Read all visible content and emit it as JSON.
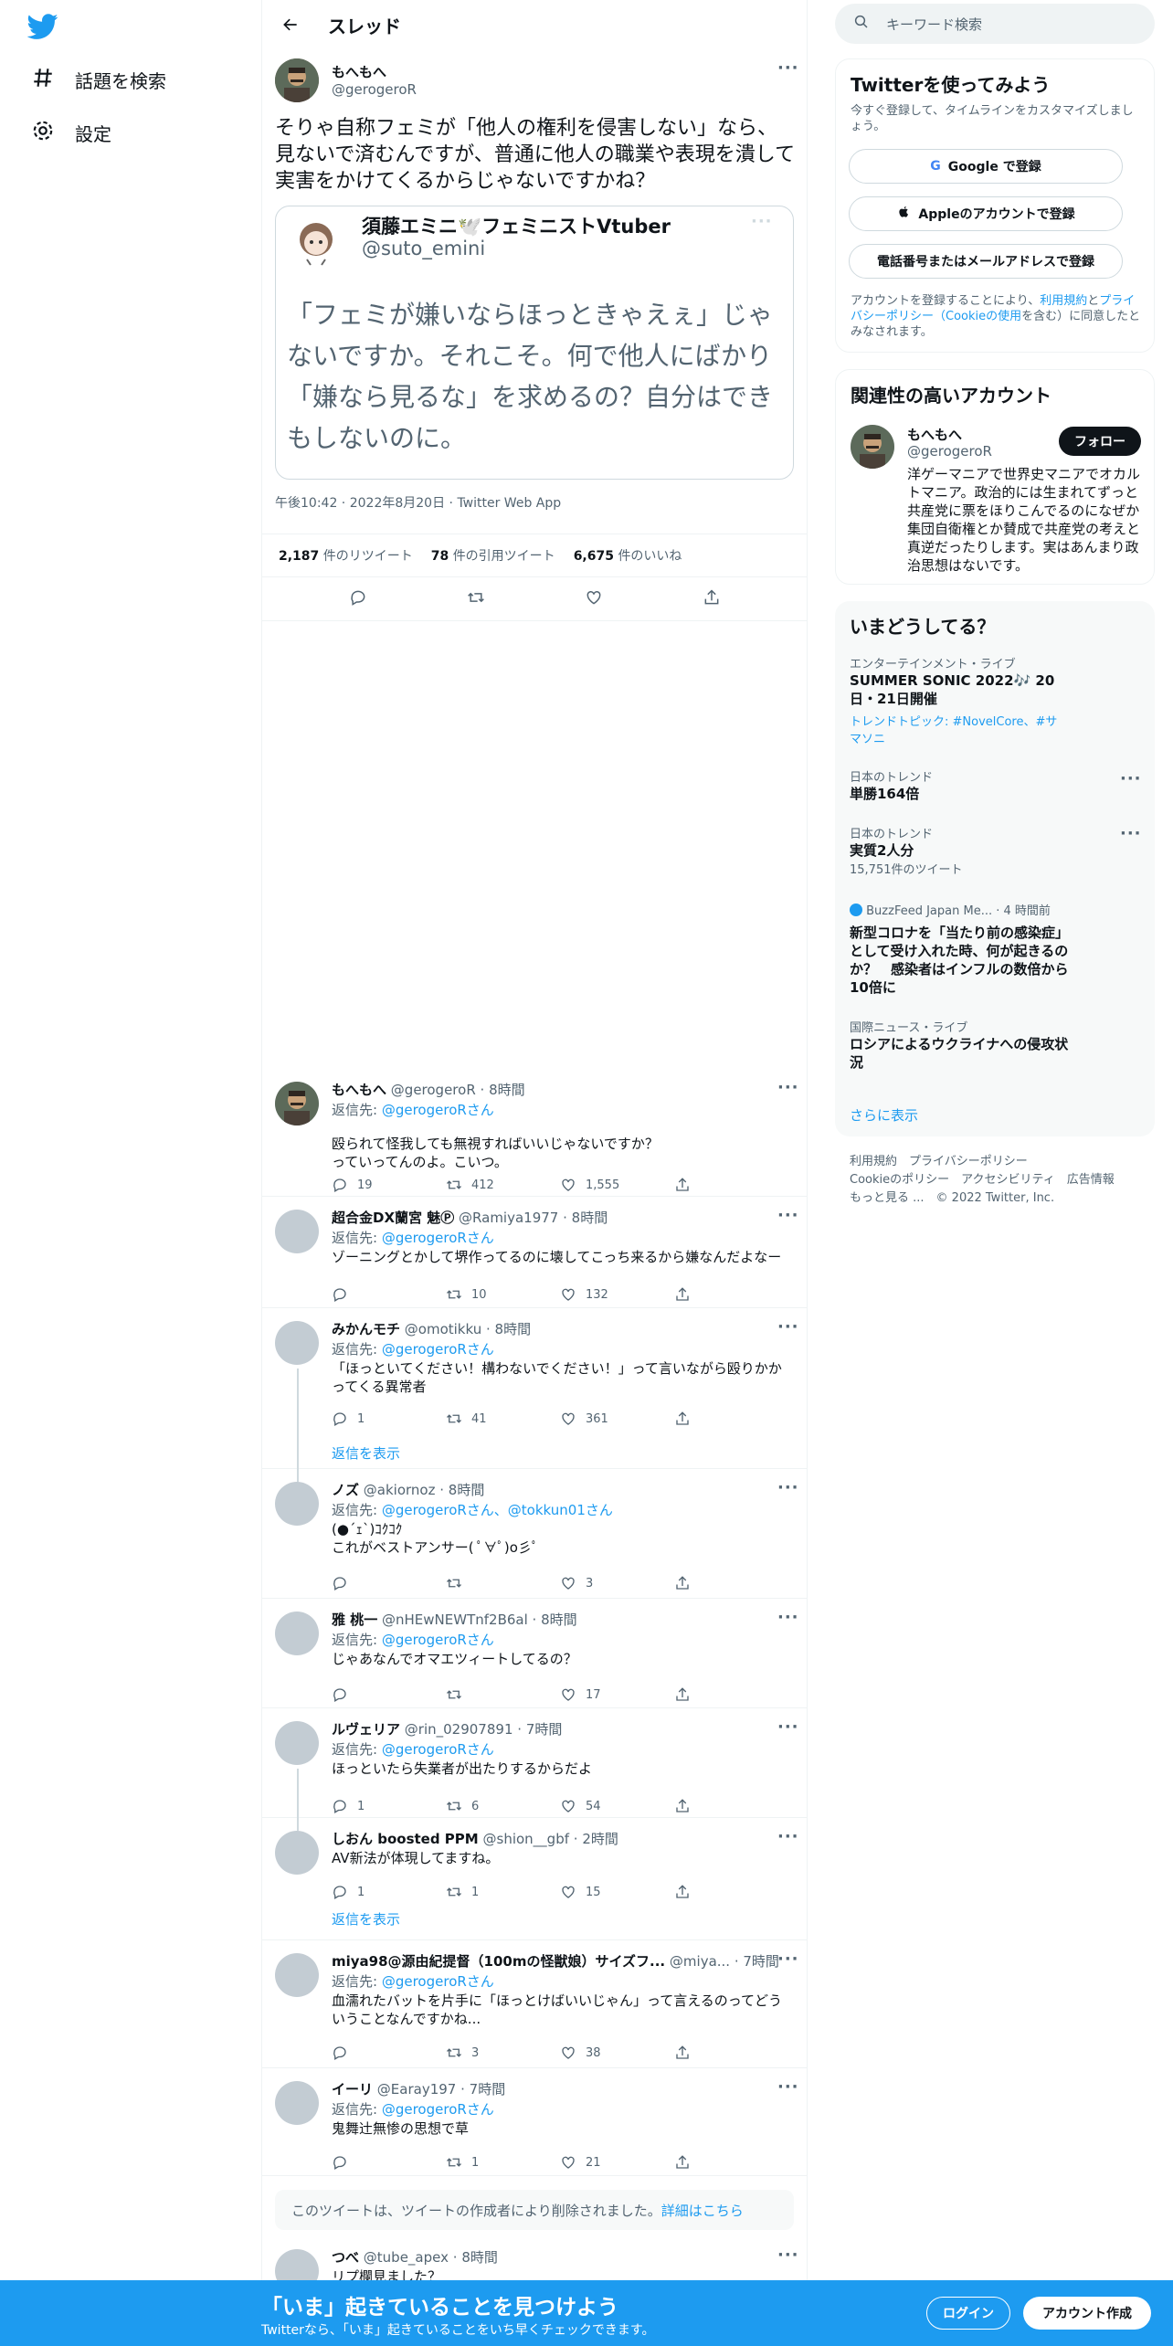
{
  "sidebar": {
    "explore": "話題を検索",
    "settings": "設定"
  },
  "header": {
    "title": "スレッド"
  },
  "tweet": {
    "name": "もへもへ",
    "handle": "@gerogeroR",
    "text": "そりゃ自称フェミが「他人の権利を侵害しない」なら、見ないで済むんですが、普通に他人の職業や表現を潰して実害をかけてくるからじゃないですかね？",
    "quote": {
      "name": "須藤エミニ🕊️フェミニストVtuber",
      "handle": "@suto_emini",
      "text": "「フェミが嫌いならほっときゃえぇ」じゃないですか。それこそ。何で他人にばかり「嫌なら見るな」を求めるの？自分はできもしないのに。"
    },
    "time": "午後10:42",
    "date": "2022年8月20日",
    "source": "Twitter Web App",
    "retweets": "2,187",
    "retweets_label": "件のリツイート",
    "quotes": "78",
    "quotes_label": "件の引用ツイート",
    "likes": "6,675",
    "likes_label": "件のいいね"
  },
  "replies": [
    {
      "name": "もへもへ",
      "handle": "@gerogeroR",
      "time": "8時間",
      "to_label": "返信先:",
      "to": "@gerogeroRさん",
      "text": "殴られて怪我しても無視すればいいじゃないですか？\nっていってんのよ。こいつ。",
      "reply": "19",
      "rt": "412",
      "like": "1,555"
    },
    {
      "name": "超合金DX蘭宮 魅Ⓟ",
      "handle": "@Ramiya1977",
      "time": "8時間",
      "to_label": "返信先:",
      "to": "@gerogeroRさん",
      "text": "ゾーニングとかして堺作ってるのに壊してこっち来るから嫌なんだよなー",
      "reply": "",
      "rt": "10",
      "like": "132"
    },
    {
      "name": "みかんモチ",
      "handle": "@omotikku",
      "time": "8時間",
      "to_label": "返信先:",
      "to": "@gerogeroRさん",
      "text": "「ほっといてください！構わないでください！」って言いながら殴りかかってくる異常者",
      "reply": "1",
      "rt": "41",
      "like": "361",
      "more": "返信を表示"
    },
    {
      "name": "ノズ",
      "handle": "@akiornoz",
      "time": "8時間",
      "to_label": "返信先:",
      "to": "@gerogeroRさん、@tokkun01さん",
      "text": "(●´ｪ`)ｺｸｺｸ\nこれがベストアンサー( ﾟ∀ﾟ)o彡ﾟ",
      "reply": "",
      "rt": "",
      "like": "3"
    },
    {
      "name": "雅 桃一",
      "handle": "@nHEwNEWTnf2B6al",
      "time": "8時間",
      "to_label": "返信先:",
      "to": "@gerogeroRさん",
      "text": "じゃあなんでオマエツィートしてるの？",
      "reply": "",
      "rt": "",
      "like": "17"
    },
    {
      "name": "ルヴェリア",
      "handle": "@rin_02907891",
      "time": "7時間",
      "to_label": "返信先:",
      "to": "@gerogeroRさん",
      "text": "ほっといたら失業者が出たりするからだよ",
      "reply": "1",
      "rt": "6",
      "like": "54"
    },
    {
      "name": "しおん boosted PPM",
      "handle": "@shion__gbf",
      "time": "2時間",
      "text": "AV新法が体現してますね。",
      "reply": "1",
      "rt": "1",
      "like": "15",
      "more": "返信を表示"
    },
    {
      "name": "miya98@源由紀提督（100mの怪獣娘）サイズフ...",
      "handle": "@miya...",
      "time": "7時間",
      "to_label": "返信先:",
      "to": "@gerogeroRさん",
      "text": "血濡れたバットを片手に「ほっとけばいいじゃん」って言えるのってどういうことなんですかね...",
      "reply": "",
      "rt": "3",
      "like": "38"
    },
    {
      "name": "イーリ",
      "handle": "@Earay197",
      "time": "7時間",
      "to_label": "返信先:",
      "to": "@gerogeroRさん",
      "text": "鬼舞辻無惨の思想で草",
      "reply": "",
      "rt": "1",
      "like": "21"
    },
    {
      "name": "つべ",
      "handle": "@tube_apex",
      "time": "8時間",
      "text": "リプ欄見ました？"
    }
  ],
  "deleted": {
    "text": "このツイートは、ツイートの作成者により削除されました。",
    "link": "詳細はこちら"
  },
  "right": {
    "search_placeholder": "キーワード検索",
    "signup": {
      "title": "Twitterを使ってみよう",
      "sub": "今すぐ登録して、タイムラインをカスタマイズしましょう。",
      "google": "Google で登録",
      "apple": "Appleのアカウントで登録",
      "phone": "電話番号またはメールアドレスで登録",
      "legal1": "アカウントを登録することにより、",
      "legal_terms": "利用規約",
      "legal2": "と",
      "legal_privacy": "プライバシーポリシー（Cookieの使用",
      "legal3": "を含む）に同意したとみなされます。"
    },
    "related": {
      "title": "関連性の高いアカウント",
      "name": "もへもへ",
      "handle": "@gerogeroR",
      "follow": "フォロー",
      "bio": "洋ゲーマニアで世界史マニアでオカルトマニア。政治的には生まれてずっと共産党に票をほりこんでるのになぜか集団自衛権とか賛成で共産党の考えと真逆だったりします。実はあんまり政治思想はないです。"
    },
    "trends": {
      "title": "いまどうしてる？",
      "items": [
        {
          "cat": "エンターテインメント・ライブ",
          "title": "SUMMER SONIC 2022🎶 20日・21日開催",
          "extra": "トレンドトピック: #NovelCore、#サマソニ"
        },
        {
          "cat": "日本のトレンド",
          "title": "単勝164倍"
        },
        {
          "cat": "日本のトレンド",
          "title": "実質2人分",
          "extra": "15,751件のツイート"
        },
        {
          "cat": "BuzzFeed Japan Me... · 4 時間前",
          "title": "新型コロナを「当たり前の感染症」として受け入れた時、何が起きるのか？　感染者はインフルの数倍から10倍に"
        },
        {
          "cat": "国際ニュース・ライブ",
          "title": "ロシアによるウクライナへの侵攻状況"
        }
      ],
      "more": "さらに表示"
    },
    "footer": {
      "l1": "利用規約",
      "l2": "プライバシーポリシー",
      "l3": "Cookieのポリシー",
      "l4": "アクセシビリティ",
      "l5": "広告情報",
      "l6": "もっと見る ...",
      "copy": "© 2022 Twitter, Inc."
    }
  },
  "bottom": {
    "title": "「いま」起きていることを見つけよう",
    "sub": "Twitterなら、「いま」起きていることをいち早くチェックできます。",
    "login": "ログイン",
    "signup": "アカウント作成"
  }
}
